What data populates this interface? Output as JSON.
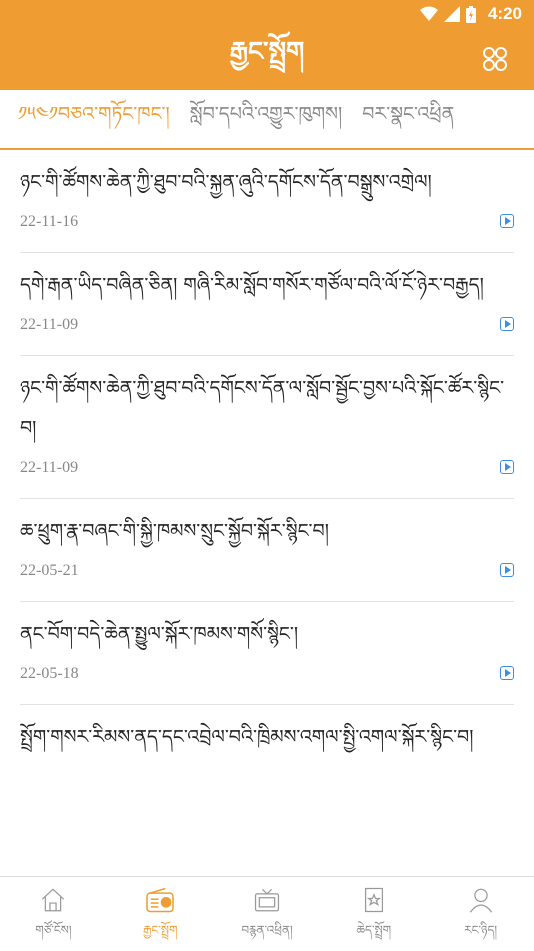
{
  "status": {
    "time": "4:20"
  },
  "app": {
    "title": "རྒྱང་སྤྲོག"
  },
  "tabs": [
    {
      "label": "༡༥༤༡བཅའ་གཏོང་ཁང་།",
      "active": true
    },
    {
      "label": "སློབ་དཔའི་འགྱུར་ཁུགས།",
      "active": false
    },
    {
      "label": "བར་སྣང་འཕྲིན",
      "active": false
    }
  ],
  "items": [
    {
      "title": "ཉང་གི་ཚོགས་ཆེན་ཀྱི་ཐུབ་བའི་སྐྱན་ཞུའི་དགོངས་དོན་བསྒྲུས་འགྲེལ།",
      "date": "22-11-16"
    },
    {
      "title": "དགེ་རྒན་ཡིད་བཞིན་ཅིན། གཞི་རིམ་སློབ་གསོར་གཙོལ་བའི་ལོ་ངོ་ཉེར་བརྒྱད།",
      "date": "22-11-09"
    },
    {
      "title": "ཉང་གི་ཚོགས་ཆེན་ཀྱི་ཐུབ་བའི་དགོངས་དོན་ལ་སློབ་སྦྱོང་བྱས་པའི་སྐོང་ཚོར་སྙིང་བ།",
      "date": "22-11-09"
    },
    {
      "title": "ཆ་ཕྲུག་རྣ་བཞང་གི་སྐྱི་ཁམས་སྲུང་སྐྱོབ་སྐོར་སྙིང་བ།",
      "date": "22-05-21"
    },
    {
      "title": "ནང་བོག་བདེ་ཆེན་སྤྱུལ་སྐོར་ཁམས་གསོ་སྙིང་།",
      "date": "22-05-18"
    },
    {
      "title": "སྤྲོག་གསར་རིམས་ནད་དང་འབྲེལ་བའི་ཁྲིམས་འགལ་སྤྱི་འགལ་སྐོར་སྙིང་བ།",
      "date": ""
    }
  ],
  "nav": [
    {
      "label": "གཙོ་ངོས།",
      "icon": "home-icon",
      "active": false
    },
    {
      "label": "རྒྱང་སྤྲོག",
      "icon": "radio-icon",
      "active": true
    },
    {
      "label": "བརྙན་འཕྲིན།",
      "icon": "tv-icon",
      "active": false
    },
    {
      "label": "ཆེད་སྤྲོག",
      "icon": "bookmark-star-icon",
      "active": false
    },
    {
      "label": "རང་ཉིད།",
      "icon": "person-icon",
      "active": false
    }
  ],
  "colors": {
    "accent": "#ef9d33",
    "play": "#3d8fe0"
  }
}
